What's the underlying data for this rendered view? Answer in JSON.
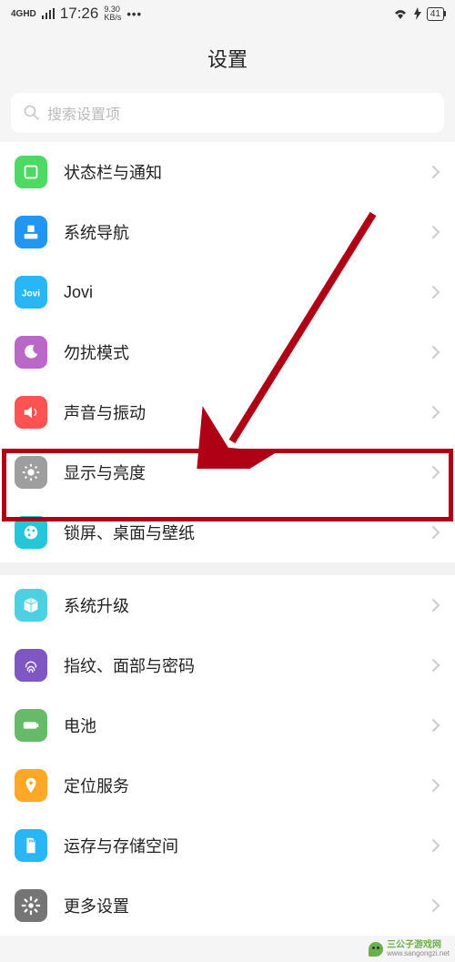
{
  "statusbar": {
    "network": "4GHD",
    "time": "17:26",
    "speed_num": "9.30",
    "speed_unit": "KB/s",
    "dots": "•••",
    "battery": "41"
  },
  "title": "设置",
  "search": {
    "placeholder": "搜索设置项"
  },
  "group1": [
    {
      "id": "status-notifications",
      "label": "状态栏与通知",
      "icon_bg": "#4cd964",
      "icon": "square"
    },
    {
      "id": "system-navigation",
      "label": "系统导航",
      "icon_bg": "#2196f3",
      "icon": "nav"
    },
    {
      "id": "jovi",
      "label": "Jovi",
      "icon_bg": "#29b6f6",
      "icon": "jovi"
    },
    {
      "id": "dnd",
      "label": "勿扰模式",
      "icon_bg": "#ba68c8",
      "icon": "moon"
    },
    {
      "id": "sound-vibration",
      "label": "声音与振动",
      "icon_bg": "#ff5252",
      "icon": "sound"
    },
    {
      "id": "display-brightness",
      "label": "显示与亮度",
      "icon_bg": "#9e9e9e",
      "icon": "brightness"
    },
    {
      "id": "lock-wallpaper",
      "label": "锁屏、桌面与壁纸",
      "icon_bg": "#26c6da",
      "icon": "palette"
    }
  ],
  "group2": [
    {
      "id": "system-upgrade",
      "label": "系统升级",
      "icon_bg": "#4dd0e1",
      "icon": "cube"
    },
    {
      "id": "biometrics",
      "label": "指纹、面部与密码",
      "icon_bg": "#7e57c2",
      "icon": "fingerprint"
    },
    {
      "id": "battery",
      "label": "电池",
      "icon_bg": "#66bb6a",
      "icon": "battery"
    },
    {
      "id": "location",
      "label": "定位服务",
      "icon_bg": "#ffa726",
      "icon": "location"
    },
    {
      "id": "storage",
      "label": "运存与存储空间",
      "icon_bg": "#29b6f6",
      "icon": "sd"
    },
    {
      "id": "more-settings",
      "label": "更多设置",
      "icon_bg": "#757575",
      "icon": "gear"
    }
  ],
  "watermark": {
    "cn": "三公子游戏网",
    "url": "www.sangongzi.net"
  },
  "annotation": {
    "highlight_target": "display-brightness",
    "arrow_color": "#b00015"
  }
}
